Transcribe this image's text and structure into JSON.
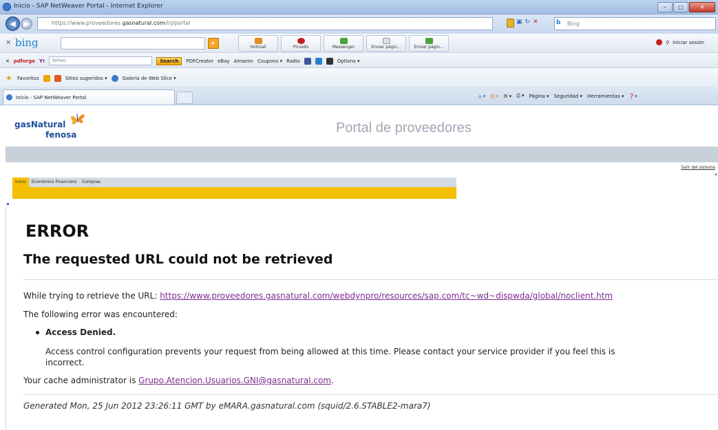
{
  "window": {
    "title": "Inicio - SAP NetWeaver Portal - Internet Explorer",
    "controls": [
      "–",
      "□",
      "✕"
    ]
  },
  "address_bar": {
    "url_prefix": "https://www.proveedores.",
    "url_domain": "gasnatural.com",
    "url_suffix": "/irj/portal",
    "search_placeholder": "Bing"
  },
  "bing_toolbar": {
    "logo": "bing",
    "buttons": [
      "Hotmail",
      "Privado",
      "Messenger",
      "Enviar págin...",
      "Enviar págin..."
    ],
    "signin": "Iniciar sesión"
  },
  "yahoo_toolbar": {
    "brand": "pdforge",
    "search_placeholder": "Yahoo",
    "search_label": "Search",
    "items": [
      "PDFCreator",
      "eBay",
      "Amazon",
      "Coupons ▾",
      "Radio"
    ],
    "options_label": "Options ▾"
  },
  "favorites_bar": {
    "label": "Favoritos",
    "items": [
      "Sitios sugeridos ▾",
      "Galería de Web Slice ▾"
    ]
  },
  "tabs": {
    "active_title": "Inicio - SAP NetWeaver Portal"
  },
  "command_bar": {
    "items": [
      "Página ▾",
      "Seguridad ▾",
      "Herramientas ▾"
    ]
  },
  "portal": {
    "logo_line1": "gasNatural",
    "logo_line2": "fenosa",
    "title": "Portal de proveedores",
    "logout": "Salir del sistema",
    "menu": [
      "Inicio",
      "Económico Financiero",
      "Compras"
    ]
  },
  "error_page": {
    "heading": "ERROR",
    "subheading": "The requested URL could not be retrieved",
    "retrieve_prefix": "While trying to retrieve the URL: ",
    "retrieve_url": "https://www.proveedores.gasnatural.com/webdynpro/resources/sap.com/tc~wd~dispwda/global/noclient.htm",
    "encountered": "The following error was encountered:",
    "error_title": "Access Denied.",
    "error_desc_line1": "Access control configuration prevents your request from being allowed at this time. Please contact your service provider if you feel this is",
    "error_desc_line2": "incorrect.",
    "admin_prefix": "Your cache administrator is ",
    "admin_email": "Grupo.Atencion.Usuarios.GNI@gasnatural.com",
    "admin_suffix": ".",
    "generated": "Generated Mon, 25 Jun 2012 23:26:11 GMT by eMARA.gasnatural.com (squid/2.6.STABLE2-mara7)"
  }
}
